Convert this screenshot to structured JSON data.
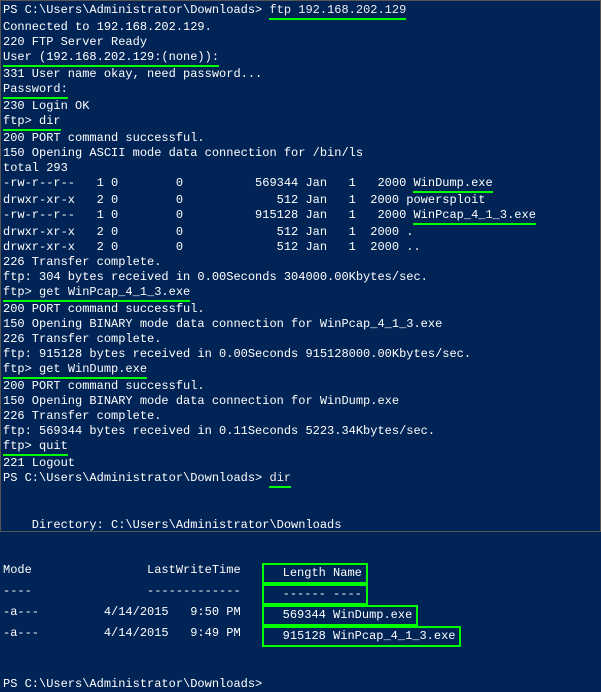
{
  "l1_prompt": "PS C:\\Users\\Administrator\\Downloads> ",
  "l1_cmd": "ftp 192.168.202.129",
  "l2": "Connected to 192.168.202.129.",
  "l3": "220 FTP Server Ready",
  "l4_a": "User (192.168.202.129:(none)):",
  "l4_b": " ",
  "l5": "331 User name okay, need password...",
  "l6_a": "Password:",
  "l6_b": " ",
  "l7": "230 Login OK",
  "l8_a": "ftp> ",
  "l8_b": "dir",
  "l9": "200 PORT command successful.",
  "l10": "150 Opening ASCII mode data connection for /bin/ls",
  "l11": "total 293",
  "l12_a": "-rw-r--r--   1 0        0          569344 Jan   1   2000 ",
  "l12_b": "WinDump.exe",
  "l13": "drwxr-xr-x   2 0        0             512 Jan   1  2000 powersploit",
  "l14_a": "-rw-r--r--   1 0        0          915128 Jan   1   2000 ",
  "l14_b": "WinPcap_4_1_3.exe",
  "l15": "drwxr-xr-x   2 0        0             512 Jan   1  2000 .",
  "l16": "drwxr-xr-x   2 0        0             512 Jan   1  2000 ..",
  "l17": "226 Transfer complete.",
  "l18": "ftp: 304 bytes received in 0.00Seconds 304000.00Kbytes/sec.",
  "l19_a": "ftp> ",
  "l19_b": "get WinPcap_4_1_3.exe",
  "l20": "200 PORT command successful.",
  "l21": "150 Opening BINARY mode data connection for WinPcap_4_1_3.exe",
  "l22": "226 Transfer complete.",
  "l23": "ftp: 915128 bytes received in 0.00Seconds 915128000.00Kbytes/sec.",
  "l24_a": "ftp> ",
  "l24_b": "get WinDump.exe",
  "l25": "200 PORT command successful.",
  "l26": "150 Opening BINARY mode data connection for WinDump.exe",
  "l27": "226 Transfer complete.",
  "l28": "ftp: 569344 bytes received in 0.11Seconds 5223.34Kbytes/sec.",
  "l29_a": "ftp> ",
  "l29_b": "quit",
  "l30": "221 Logout",
  "l31_prompt": "PS C:\\Users\\Administrator\\Downloads> ",
  "l31_cmd": "dir",
  "dir_header": "    Directory: C:\\Users\\Administrator\\Downloads",
  "th_left": "Mode                LastWriteTime   ",
  "th_right": "  Length Name",
  "tdash_left": "----                -------------   ",
  "tdash_right": "  ------ ----",
  "tr1_left": "-a---         4/14/2015   9:50 PM   ",
  "tr1_right": "  569344 WinDump.exe",
  "tr2_left": "-a---         4/14/2015   9:49 PM   ",
  "tr2_right": "  915128 WinPcap_4_1_3.exe",
  "final_prompt": "PS C:\\Users\\Administrator\\Downloads>",
  "chart_data": {
    "type": "table",
    "title": "Directory: C:\\Users\\Administrator\\Downloads",
    "columns": [
      "Mode",
      "LastWriteTime",
      "Length",
      "Name"
    ],
    "rows": [
      {
        "Mode": "-a---",
        "LastWriteTime": "4/14/2015 9:50 PM",
        "Length": 569344,
        "Name": "WinDump.exe"
      },
      {
        "Mode": "-a---",
        "LastWriteTime": "4/14/2015 9:49 PM",
        "Length": 915128,
        "Name": "WinPcap_4_1_3.exe"
      }
    ],
    "ftp_listing": [
      {
        "perm": "-rw-r--r--",
        "links": 1,
        "owner": 0,
        "group": 0,
        "size": 569344,
        "date": "Jan 1 2000",
        "name": "WinDump.exe"
      },
      {
        "perm": "drwxr-xr-x",
        "links": 2,
        "owner": 0,
        "group": 0,
        "size": 512,
        "date": "Jan 1 2000",
        "name": "powersploit"
      },
      {
        "perm": "-rw-r--r--",
        "links": 1,
        "owner": 0,
        "group": 0,
        "size": 915128,
        "date": "Jan 1 2000",
        "name": "WinPcap_4_1_3.exe"
      },
      {
        "perm": "drwxr-xr-x",
        "links": 2,
        "owner": 0,
        "group": 0,
        "size": 512,
        "date": "Jan 1 2000",
        "name": "."
      },
      {
        "perm": "drwxr-xr-x",
        "links": 2,
        "owner": 0,
        "group": 0,
        "size": 512,
        "date": "Jan 1 2000",
        "name": ".."
      }
    ]
  }
}
